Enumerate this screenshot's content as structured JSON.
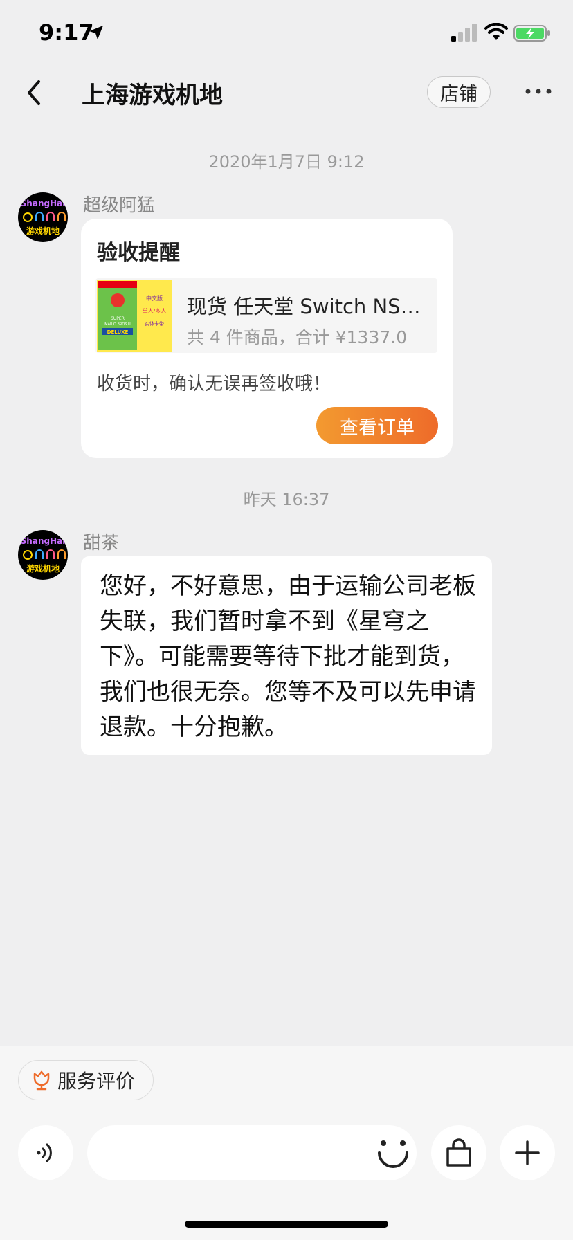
{
  "status_bar": {
    "time": "9:17"
  },
  "nav": {
    "title": "上海游戏机地",
    "shop_label": "店铺"
  },
  "messages": [
    {
      "timestamp": "2020年1月7日 9:12",
      "sender": "超级阿猛",
      "card": {
        "title": "验收提醒",
        "product_name": "现货 任天堂 Switch NS 新超级马里奥兄弟U 豪华版",
        "product_summary": "共 4 件商品，合计 ¥1337.0",
        "note": "收货时，确认无误再签收哦！",
        "button_label": "查看订单"
      }
    },
    {
      "timestamp": "昨天 16:37",
      "sender": "甜茶",
      "text": "您好，不好意思，由于运输公司老板失联，我们暂时拿不到《星穹之下》。可能需要等待下批才能到货，我们也很无奈。您等不及可以先申请退款。十分抱歉。"
    }
  ],
  "avatar": {
    "text": "ShangHai",
    "bottom_text": "游戏机地"
  },
  "product_image": {
    "brand": "SUPER",
    "title": "MARIO BROS.U",
    "edition": "DELUXE",
    "badge1": "中文版",
    "badge2": "单人/多人",
    "badge3": "实体卡带"
  },
  "bottom": {
    "review_label": "服务评价",
    "input_value": "",
    "input_placeholder": ""
  },
  "colors": {
    "accent_orange": "#ee6b2a",
    "background": "#efeff0"
  },
  "icons": [
    "back-icon",
    "more-icon",
    "voice-icon",
    "emoji-icon",
    "shopping-bag-icon",
    "plus-icon",
    "review-icon"
  ]
}
